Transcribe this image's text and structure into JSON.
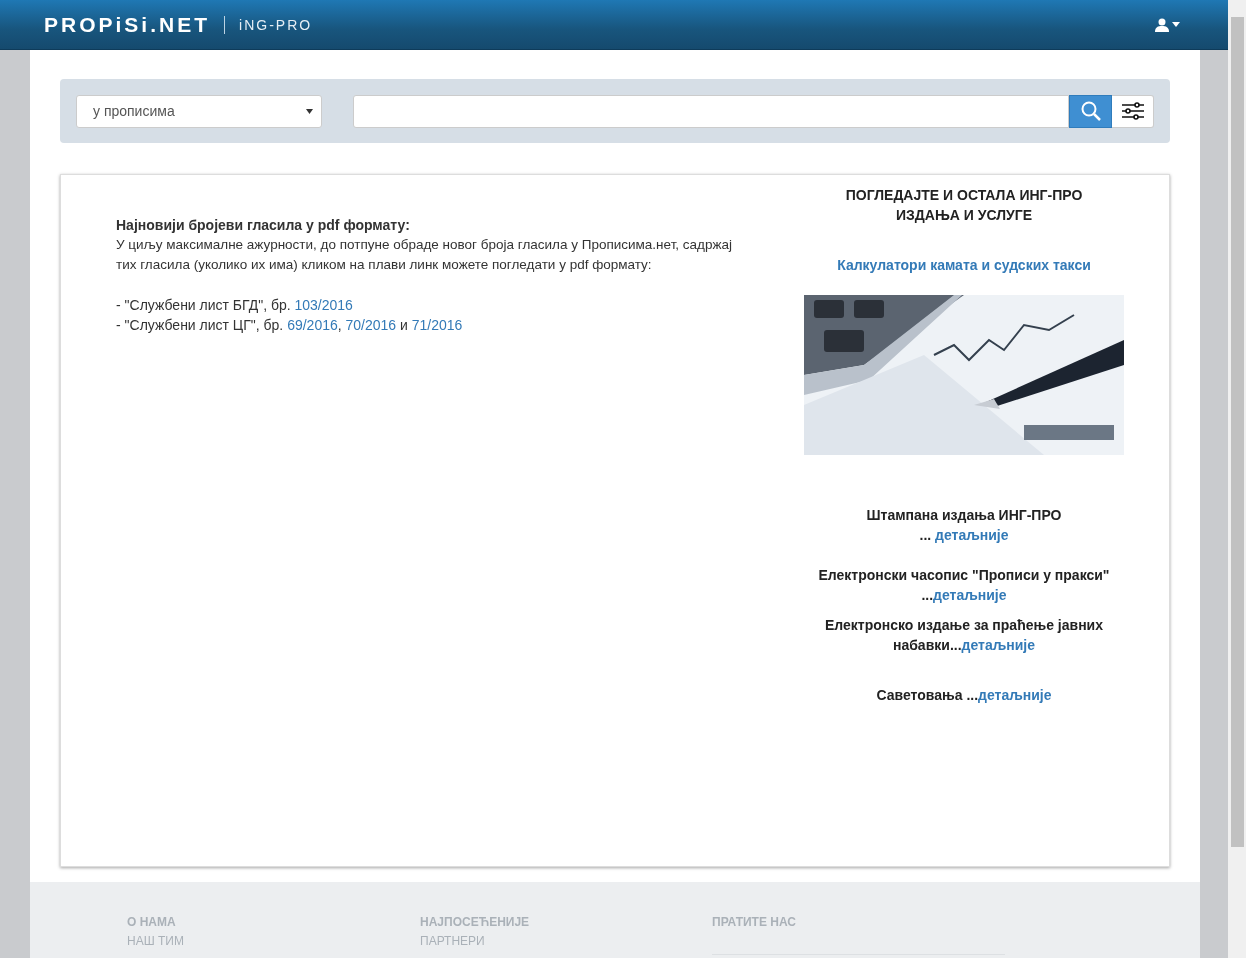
{
  "header": {
    "logo": "PROPiSi.NET",
    "sublogo": "iNG-PRO"
  },
  "search": {
    "scope": "у прописима"
  },
  "notice": {
    "heading": "Најновији бројеви гласила у pdf формату:",
    "body": "У циљу максималне ажурности, до потпуне обраде новог броја гласила у Прописима.нет, садржај тих гласила (уколико их има) кликом на плави линк можете погледати у pdf формату:",
    "lines": [
      [
        {
          "kind": "text",
          "text": "- \"Службени лист БГД\", бр. "
        },
        {
          "kind": "link",
          "text": "103/2016"
        }
      ],
      [
        {
          "kind": "text",
          "text": "- \"Службени лист ЦГ\", бр. "
        },
        {
          "kind": "link",
          "text": "69/2016"
        },
        {
          "kind": "text",
          "text": ", "
        },
        {
          "kind": "link",
          "text": "70/2016"
        },
        {
          "kind": "text",
          "text": " и "
        },
        {
          "kind": "link",
          "text": "71/2016"
        }
      ]
    ]
  },
  "aside": {
    "title": "ПОГЛЕДАЈТЕ И ОСТАЛА ИНГ-ПРО ИЗДАЊА И УСЛУГЕ",
    "calculator_link": "Калкулатори камата и судских такси",
    "items": [
      {
        "text": "Штампана издања ИНГ-ПРО",
        "continuation": "... ",
        "link": "детаљније"
      },
      {
        "text": "Електронски часопис \"Прописи у пракси\"",
        "continuation": "...",
        "link": "детаљније"
      },
      {
        "text": "Електронско издање за праћење јавних набавки...",
        "link": "детаљније"
      },
      {
        "text": "Саветовања ...",
        "link": "детаљније"
      }
    ]
  },
  "footer": {
    "columns": [
      {
        "heading": "О НАМА",
        "links": [
          "НАШ ТИМ"
        ]
      },
      {
        "heading": "НАЈПОСЕЋЕНИЈЕ",
        "links": [
          "ПАРТНЕРИ"
        ]
      },
      {
        "heading": "ПРАТИТЕ НАС"
      }
    ]
  }
}
